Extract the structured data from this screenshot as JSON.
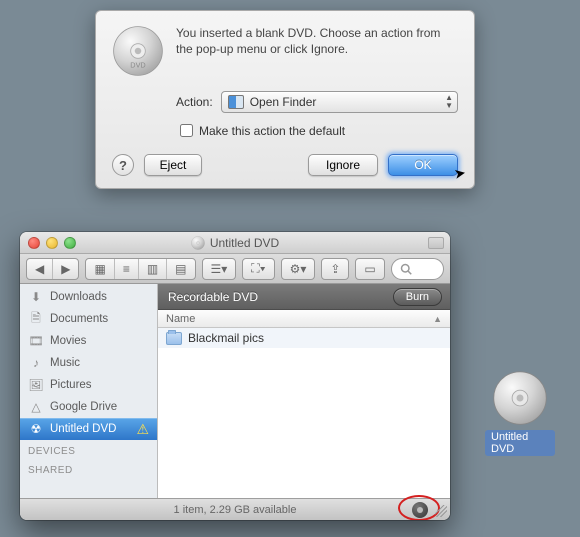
{
  "dialog": {
    "message": "You inserted a blank DVD. Choose an action from the pop-up menu or click Ignore.",
    "action_label": "Action:",
    "action_value": "Open Finder",
    "default_checkbox_label": "Make this action the default",
    "help_glyph": "?",
    "eject_label": "Eject",
    "ignore_label": "Ignore",
    "ok_label": "OK"
  },
  "finder": {
    "title": "Untitled DVD",
    "sidebar": {
      "items": [
        {
          "label": "Downloads"
        },
        {
          "label": "Documents"
        },
        {
          "label": "Movies"
        },
        {
          "label": "Music"
        },
        {
          "label": "Pictures"
        },
        {
          "label": "Google Drive"
        },
        {
          "label": "Untitled DVD"
        }
      ],
      "sections": [
        "DEVICES",
        "SHARED"
      ]
    },
    "banner_title": "Recordable DVD",
    "burn_label": "Burn",
    "column_name": "Name",
    "rows": [
      {
        "name": "Blackmail pics"
      }
    ],
    "status": "1 item, 2.29 GB available"
  },
  "desktop": {
    "label": "Untitled DVD"
  }
}
